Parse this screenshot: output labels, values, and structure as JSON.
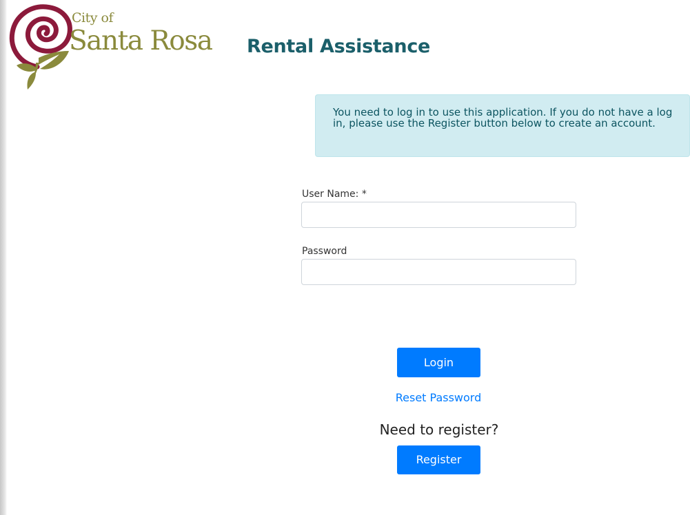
{
  "logo": {
    "city_of": "City of",
    "name": "Santa Rosa"
  },
  "page": {
    "title": "Rental Assistance"
  },
  "alert": {
    "message": "You need to log in to use this application. If you do not have a log in, please use the Register button below to create an account."
  },
  "form": {
    "username_label": "User Name: *",
    "username_value": "",
    "password_label": "Password",
    "password_value": "",
    "login_label": "Login",
    "reset_password_label": "Reset Password",
    "register_heading": "Need to register?",
    "register_label": "Register"
  },
  "colors": {
    "title": "#1b5f6a",
    "logo_text": "#8a8a3c",
    "logo_rose": "#8c1a3b",
    "logo_leaf": "#8a8a3c",
    "alert_bg": "#d1ecf1",
    "alert_text": "#0c5460",
    "primary": "#007bff"
  }
}
